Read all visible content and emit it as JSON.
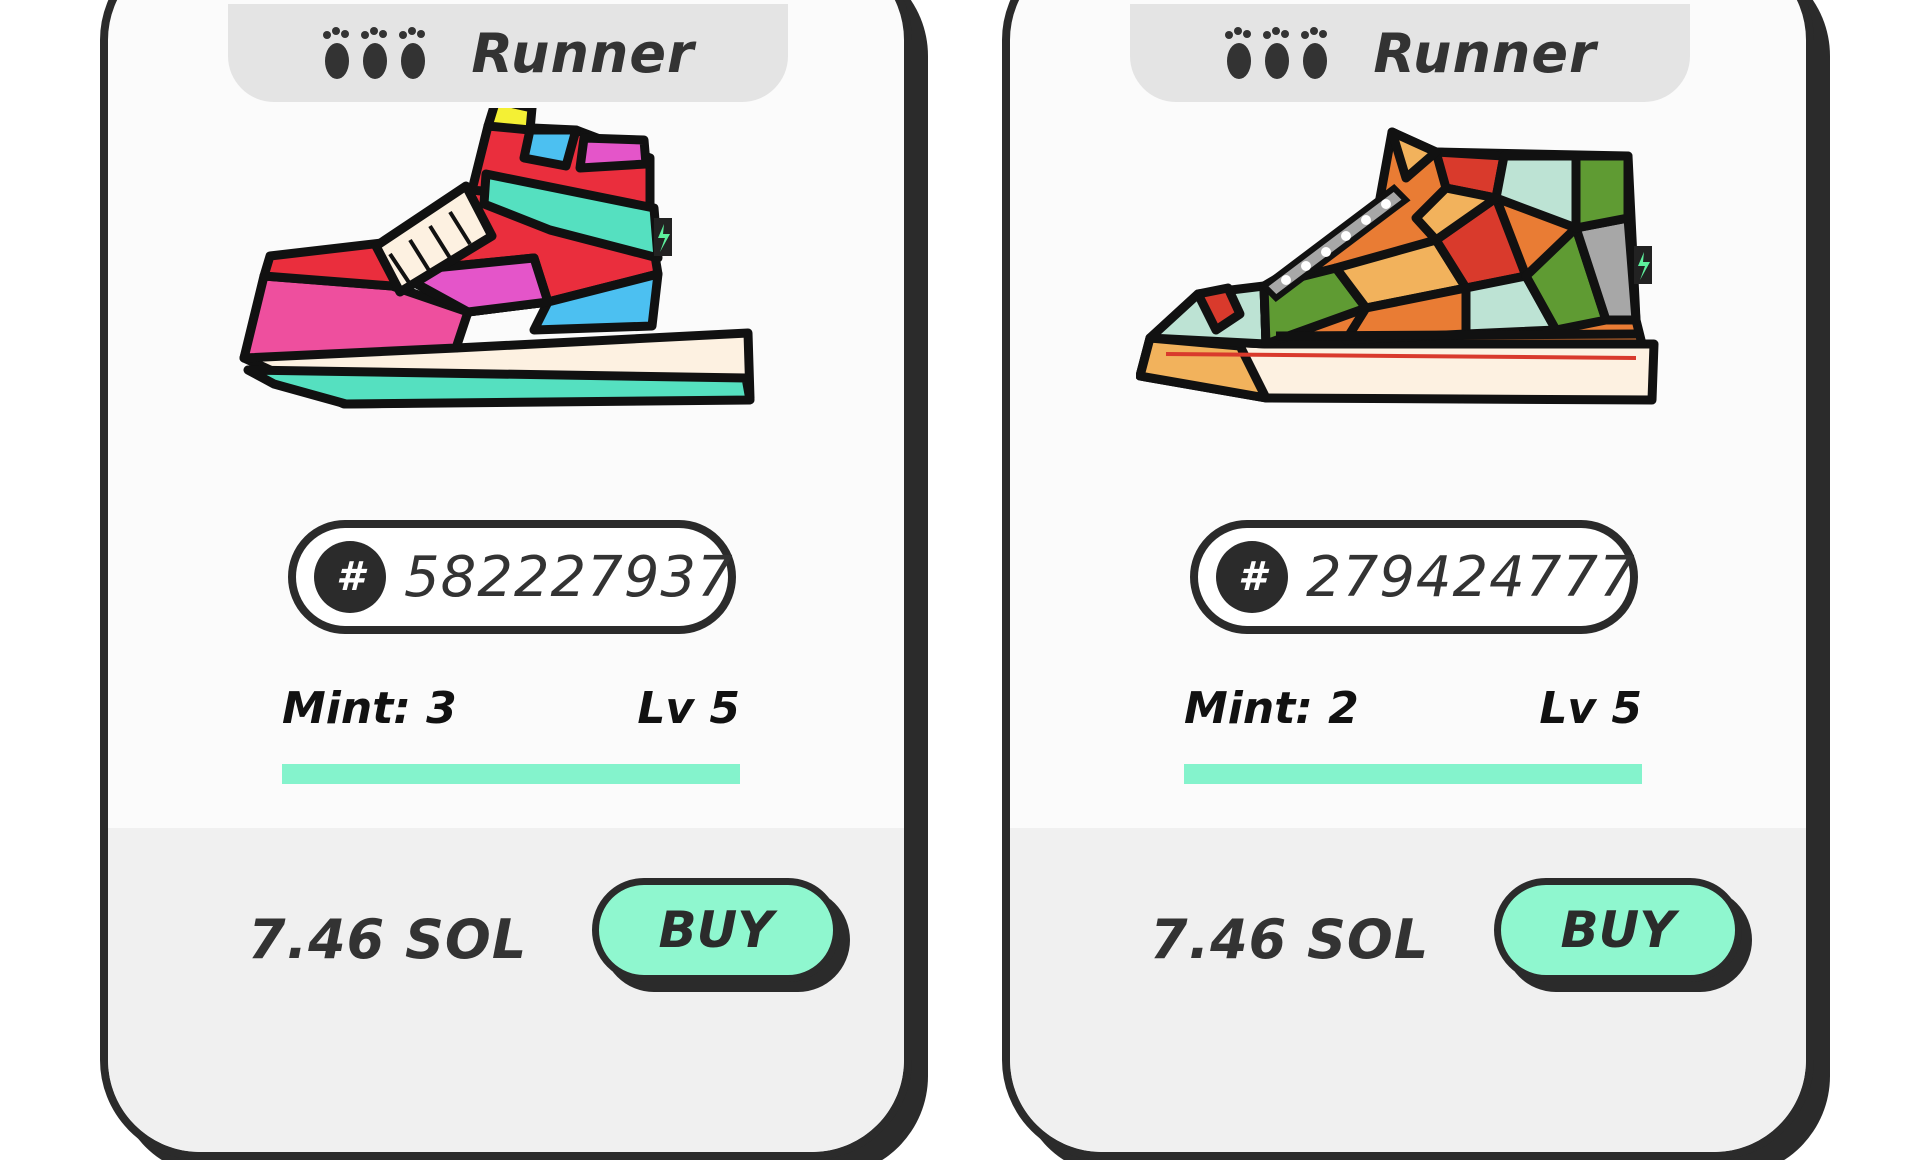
{
  "colors": {
    "accent": "#8ff7cf",
    "progress": "#84f3cc",
    "outline": "#2b2b2b",
    "tab": "#e4e4e4",
    "footer": "#f0f0f0"
  },
  "cards": [
    {
      "category_icon": "footprints-icon",
      "category": "Runner",
      "image": "sneaker-colorful-high-top",
      "id_icon": "hash-icon",
      "id": "582227937",
      "mint": "Mint: 3",
      "level": "Lv 5",
      "progress": 1.0,
      "price": "7.46 SOL",
      "buy_label": "BUY"
    },
    {
      "category_icon": "footprints-icon",
      "category": "Runner",
      "image": "sneaker-geometric-high-top",
      "id_icon": "hash-icon",
      "id": "279424777",
      "mint": "Mint: 2",
      "level": "Lv 5",
      "progress": 1.0,
      "price": "7.46 SOL",
      "buy_label": "BUY"
    }
  ]
}
